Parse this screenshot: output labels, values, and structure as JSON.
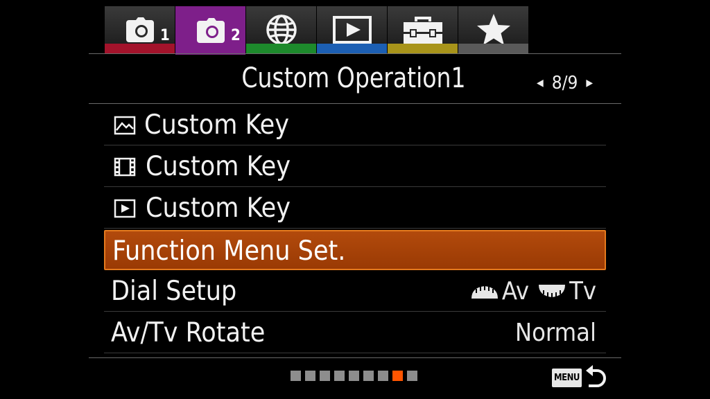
{
  "tabs": [
    {
      "icon": "camera-icon",
      "num": "1",
      "stripe": "#a3132b",
      "active": false
    },
    {
      "icon": "camera-icon",
      "num": "2",
      "stripe": "#7e1f8a",
      "active": true
    },
    {
      "icon": "globe-icon",
      "num": "",
      "stripe": "#1d8a2c",
      "active": false
    },
    {
      "icon": "play-icon",
      "num": "",
      "stripe": "#1c5fb3",
      "active": false
    },
    {
      "icon": "toolbox-icon",
      "num": "",
      "stripe": "#a8941a",
      "active": false
    },
    {
      "icon": "star-icon",
      "num": "",
      "stripe": "#5a5a5a",
      "active": false
    }
  ],
  "header": {
    "title": "Custom Operation1",
    "page": "8/9"
  },
  "menu": [
    {
      "label": "Custom Key",
      "icon": "still-image-icon",
      "value": ""
    },
    {
      "label": "Custom Key",
      "icon": "movie-icon",
      "value": ""
    },
    {
      "label": "Custom Key",
      "icon": "playback-icon",
      "value": ""
    },
    {
      "label": "Function Menu Set.",
      "icon": "",
      "value": ""
    },
    {
      "label": "Dial Setup",
      "icon": "",
      "value_parts": [
        "Av",
        "Tv"
      ]
    },
    {
      "label": "Av/Tv Rotate",
      "icon": "",
      "value": "Normal"
    }
  ],
  "selected_index": 3,
  "colors": {
    "selected": "#a84207",
    "active_tab": "#7e1f8a",
    "dot_active": "#ff5500"
  },
  "pagination": {
    "count": 9,
    "active": 7
  },
  "footer": {
    "menu_label": "MENU",
    "back_icon": "return-arrow-icon"
  }
}
